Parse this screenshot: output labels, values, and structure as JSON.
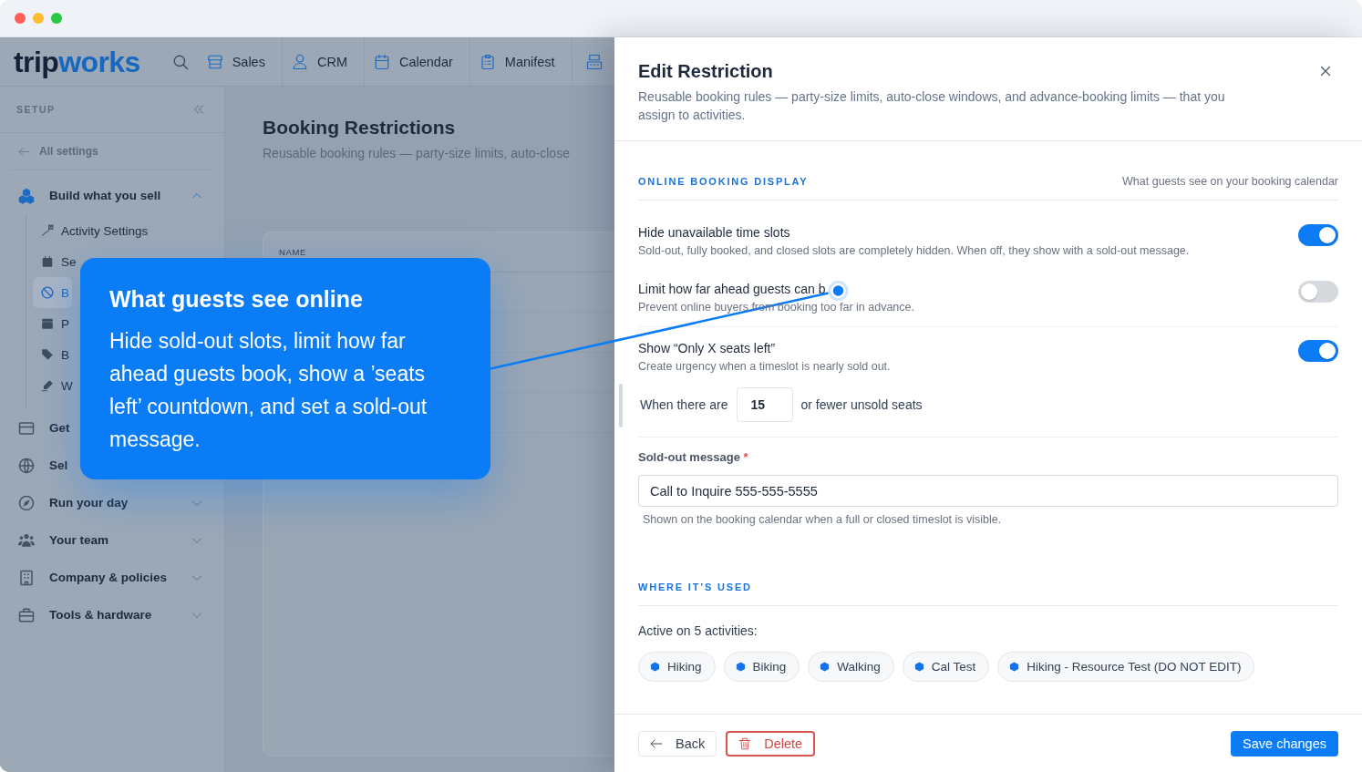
{
  "nav": {
    "logo": [
      "trip",
      "works"
    ],
    "items": [
      {
        "label": "Sales"
      },
      {
        "label": "CRM"
      },
      {
        "label": "Calendar"
      },
      {
        "label": "Manifest"
      }
    ]
  },
  "sidebar": {
    "heading": "SETUP",
    "back_link": "All settings",
    "groups": [
      {
        "label": "Build what you sell",
        "expanded": true,
        "children": [
          {
            "label": "Activity Settings",
            "selected": false
          },
          {
            "label": "Se",
            "selected": false
          },
          {
            "label": "B",
            "selected": true
          },
          {
            "label": "P",
            "selected": false
          },
          {
            "label": "B",
            "selected": false
          },
          {
            "label": "W",
            "selected": false
          }
        ]
      },
      {
        "label": "Get"
      },
      {
        "label": "Sel"
      },
      {
        "label": "Run your day",
        "expanded": false
      },
      {
        "label": "Your team",
        "expanded": false
      },
      {
        "label": "Company & policies",
        "expanded": false
      },
      {
        "label": "Tools & hardware",
        "expanded": false
      }
    ]
  },
  "page": {
    "title": "Booking Restrictions",
    "subtitle": "Reusable booking rules — party-size limits, auto-close",
    "table": {
      "columns": [
        "NAME"
      ]
    }
  },
  "callout": {
    "title": "What guests see online",
    "body": "Hide sold-out slots, limit how far ahead guests book, show a ’seats left’ countdown, and set a sold-out message."
  },
  "drawer": {
    "title": "Edit Restriction",
    "description": "Reusable booking rules — party-size limits, auto-close windows, and advance-booking limits — that you assign to activities.",
    "sections": [
      {
        "heading": "ONLINE BOOKING DISPLAY",
        "note": "What guests see on your booking calendar",
        "groups": [
          [
            {
              "kind": "toggle",
              "label": "Hide unavailable time slots",
              "description": "Sold-out, fully booked, and closed slots are completely hidden. When off, they show with a sold-out message.",
              "on": true
            },
            {
              "kind": "toggle",
              "label": "Limit how far ahead guests can b",
              "description": "Prevent online buyers from booking too far in advance.",
              "on": false
            }
          ],
          [
            {
              "kind": "toggle",
              "label": "Show “Only X seats left”",
              "description": "Create urgency when a timeslot is nearly sold out.",
              "on": true
            },
            {
              "kind": "threshold",
              "prefix": "When there are",
              "value": "15",
              "suffix": "or fewer unsold seats"
            }
          ],
          [
            {
              "kind": "text_field",
              "label": "Sold-out message",
              "required_mark": "*",
              "value": "Call to Inquire 555-555-5555",
              "help": "Shown on the booking calendar when a full or closed timeslot is visible."
            }
          ]
        ]
      },
      {
        "heading": "WHERE IT’S USED",
        "groups": [
          [
            {
              "kind": "chips",
              "summary": "Active on 5 activities:",
              "chips": [
                "Hiking",
                "Biking",
                "Walking",
                "Cal Test",
                "Hiking - Resource Test (DO NOT EDIT)"
              ]
            }
          ]
        ]
      }
    ],
    "footer": {
      "back": "Back",
      "delete": "Delete",
      "save": "Save changes"
    }
  }
}
